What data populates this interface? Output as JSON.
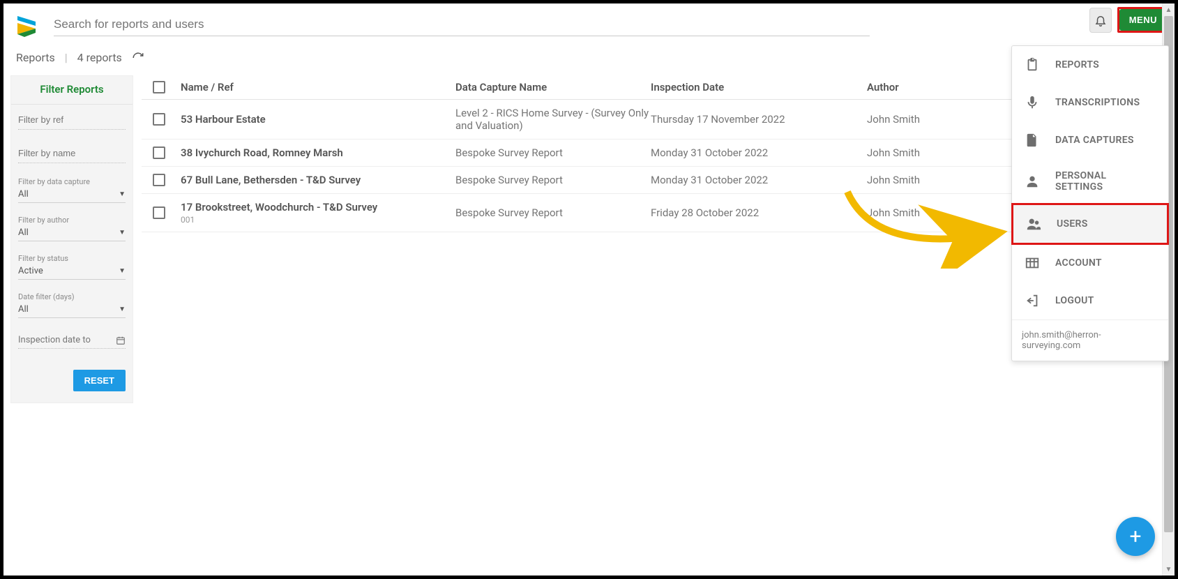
{
  "search": {
    "placeholder": "Search for reports and users"
  },
  "top": {
    "menu_label": "MENU"
  },
  "subheader": {
    "title": "Reports",
    "count_label": "4 reports"
  },
  "filter": {
    "title": "Filter Reports",
    "ref_placeholder": "Filter by ref",
    "name_placeholder": "Filter by name",
    "dc_label": "Filter by data capture",
    "dc_value": "All",
    "author_label": "Filter by author",
    "author_value": "All",
    "status_label": "Filter by status",
    "status_value": "Active",
    "datefilter_label": "Date filter (days)",
    "datefilter_value": "All",
    "insp_to_label": "Inspection date to",
    "reset_label": "RESET"
  },
  "columns": {
    "name": "Name / Ref",
    "dc": "Data Capture Name",
    "date": "Inspection Date",
    "author": "Author"
  },
  "rows": [
    {
      "name": "53 Harbour Estate",
      "ref": "",
      "dc": "Level 2 - RICS Home Survey - (Survey Only and Valuation)",
      "date": "Thursday 17 November 2022",
      "author": "John Smith"
    },
    {
      "name": "38 Ivychurch Road, Romney Marsh",
      "ref": "",
      "dc": "Bespoke Survey Report",
      "date": "Monday 31 October 2022",
      "author": "John Smith"
    },
    {
      "name": "67 Bull Lane, Bethersden - T&D Survey",
      "ref": "",
      "dc": "Bespoke Survey Report",
      "date": "Monday 31 October 2022",
      "author": "John Smith"
    },
    {
      "name": "17 Brookstreet, Woodchurch - T&D Survey",
      "ref": "001",
      "dc": "Bespoke Survey Report",
      "date": "Friday 28 October 2022",
      "author": "John Smith"
    }
  ],
  "menu": {
    "items": [
      {
        "label": "REPORTS",
        "icon": "clipboard-icon"
      },
      {
        "label": "TRANSCRIPTIONS",
        "icon": "mic-icon"
      },
      {
        "label": "DATA CAPTURES",
        "icon": "file-icon"
      },
      {
        "label": "PERSONAL SETTINGS",
        "icon": "person-icon"
      },
      {
        "label": "USERS",
        "icon": "people-icon",
        "highlight": true
      },
      {
        "label": "ACCOUNT",
        "icon": "grid-icon"
      },
      {
        "label": "LOGOUT",
        "icon": "logout-icon"
      }
    ],
    "footer": "john.smith@herron-surveying.com"
  },
  "fab": {
    "label": "+"
  }
}
